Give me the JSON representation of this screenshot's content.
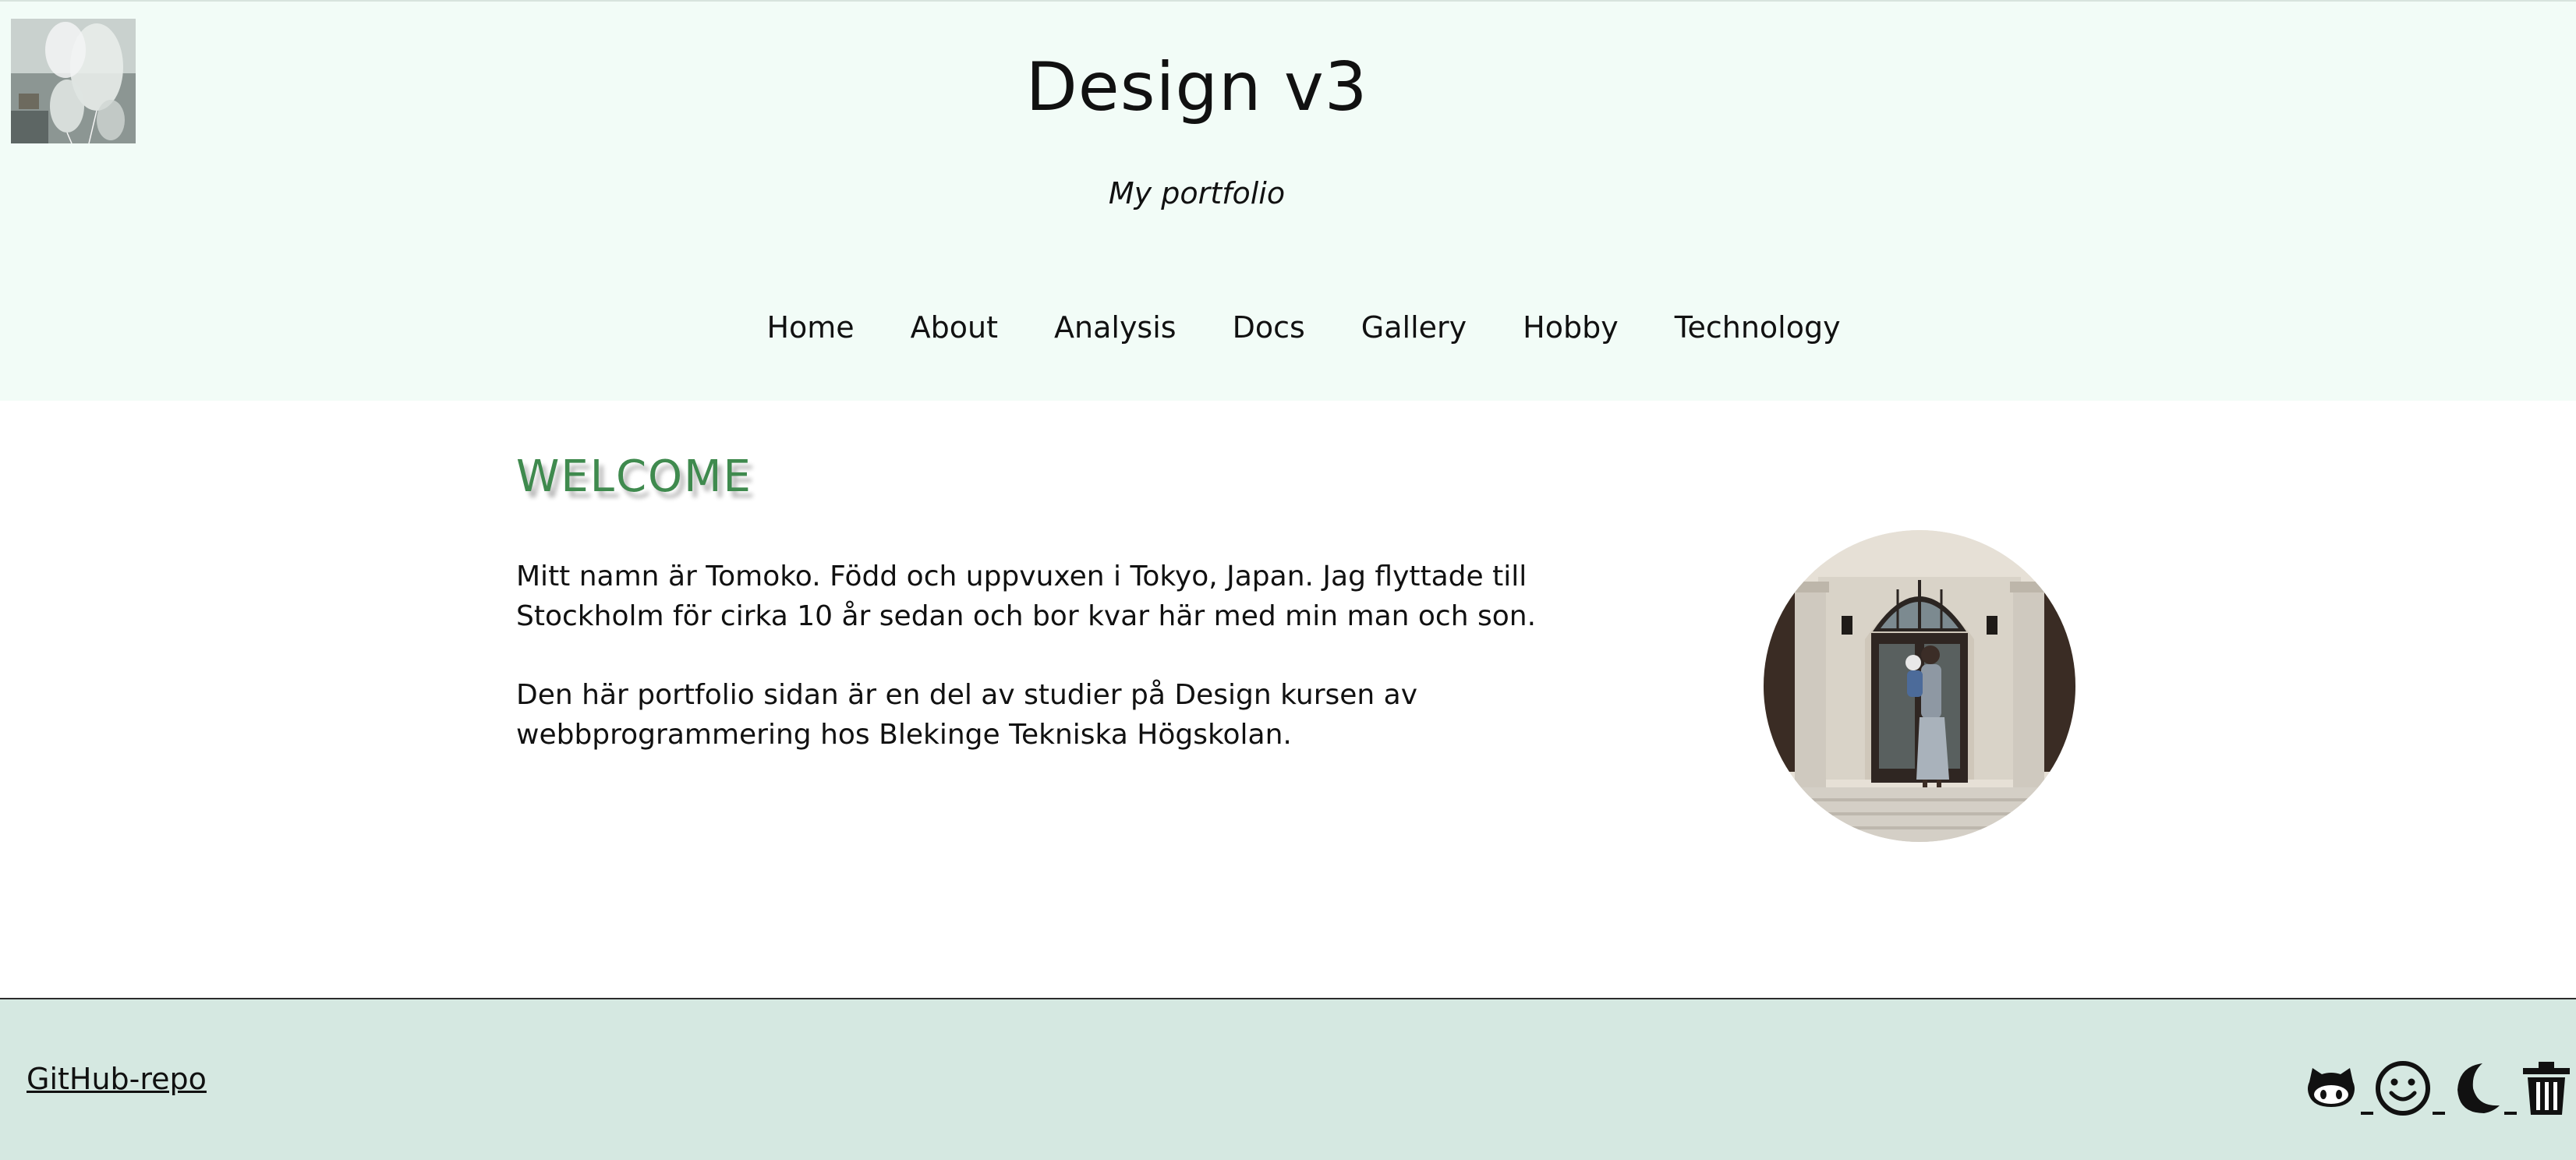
{
  "header": {
    "title": "Design v3",
    "slogan": "My portfolio",
    "logo_alt": "balloons-logo"
  },
  "nav": {
    "items": [
      {
        "label": "Home"
      },
      {
        "label": "About"
      },
      {
        "label": "Analysis"
      },
      {
        "label": "Docs"
      },
      {
        "label": "Gallery"
      },
      {
        "label": "Hobby"
      },
      {
        "label": "Technology"
      }
    ]
  },
  "main": {
    "heading": "WELCOME",
    "paragraphs": [
      "Mitt namn är Tomoko. Född och uppvuxen i Tokyo, Japan. Jag flyttade till Stockholm för cirka 10 år sedan och bor kvar här med min man och son.",
      "Den här portfolio sidan är en del av studier på Design kursen av webbprogrammering hos Blekinge Tekniska Högskolan."
    ],
    "photo_alt": "profile-photo"
  },
  "footer": {
    "repo_link": "GitHub-repo",
    "icons": [
      "github-icon",
      "smiley-icon",
      "moon-icon",
      "trash-icon"
    ]
  },
  "colors": {
    "header_bg": "#f2fcf7",
    "footer_bg": "#d5e8e1",
    "welcome_heading": "#3f8a4e"
  }
}
